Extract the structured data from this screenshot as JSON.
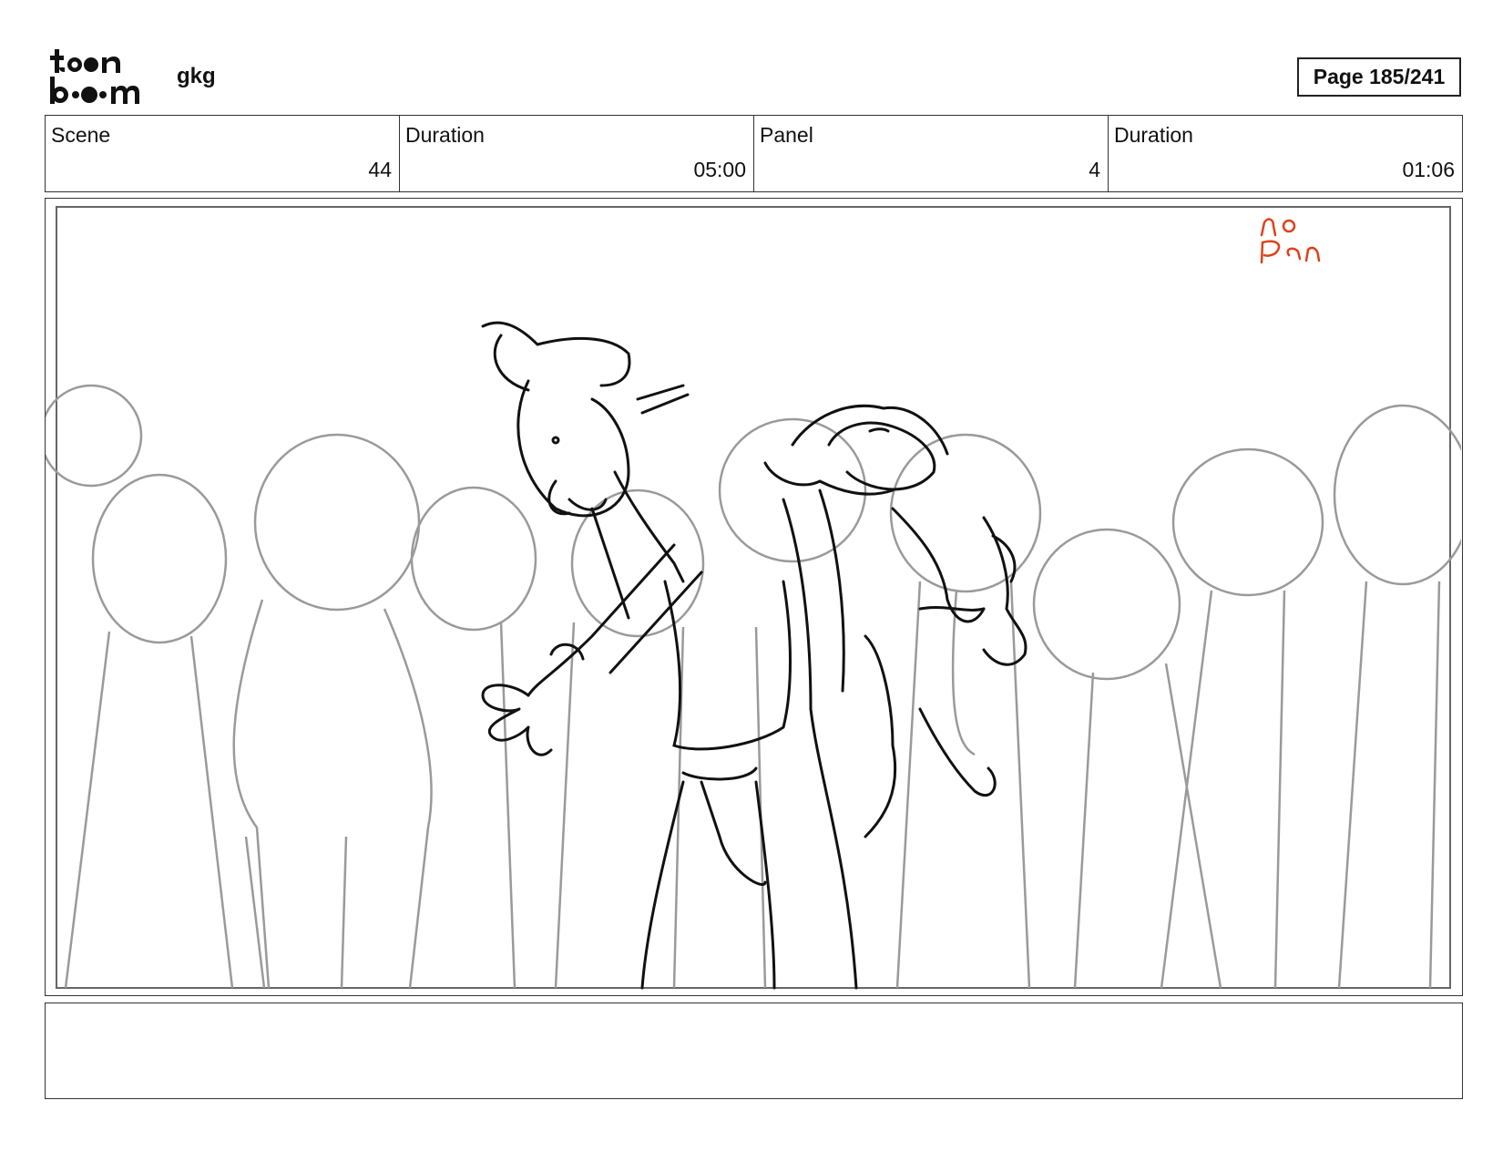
{
  "header": {
    "logo_text": "toon boom",
    "project": "gkg",
    "page_label": "Page 185/241"
  },
  "info": [
    {
      "label": "Scene",
      "value": "44"
    },
    {
      "label": "Duration",
      "value": "05:00"
    },
    {
      "label": "Panel",
      "value": "4"
    },
    {
      "label": "Duration",
      "value": "01:06"
    }
  ],
  "panel": {
    "annotation_lines": [
      "no",
      "Pan"
    ],
    "annotation_color": "#e0401c",
    "sketch_color": "#111111",
    "crowd_color": "#9a9a9a"
  },
  "notes": {
    "text": ""
  }
}
